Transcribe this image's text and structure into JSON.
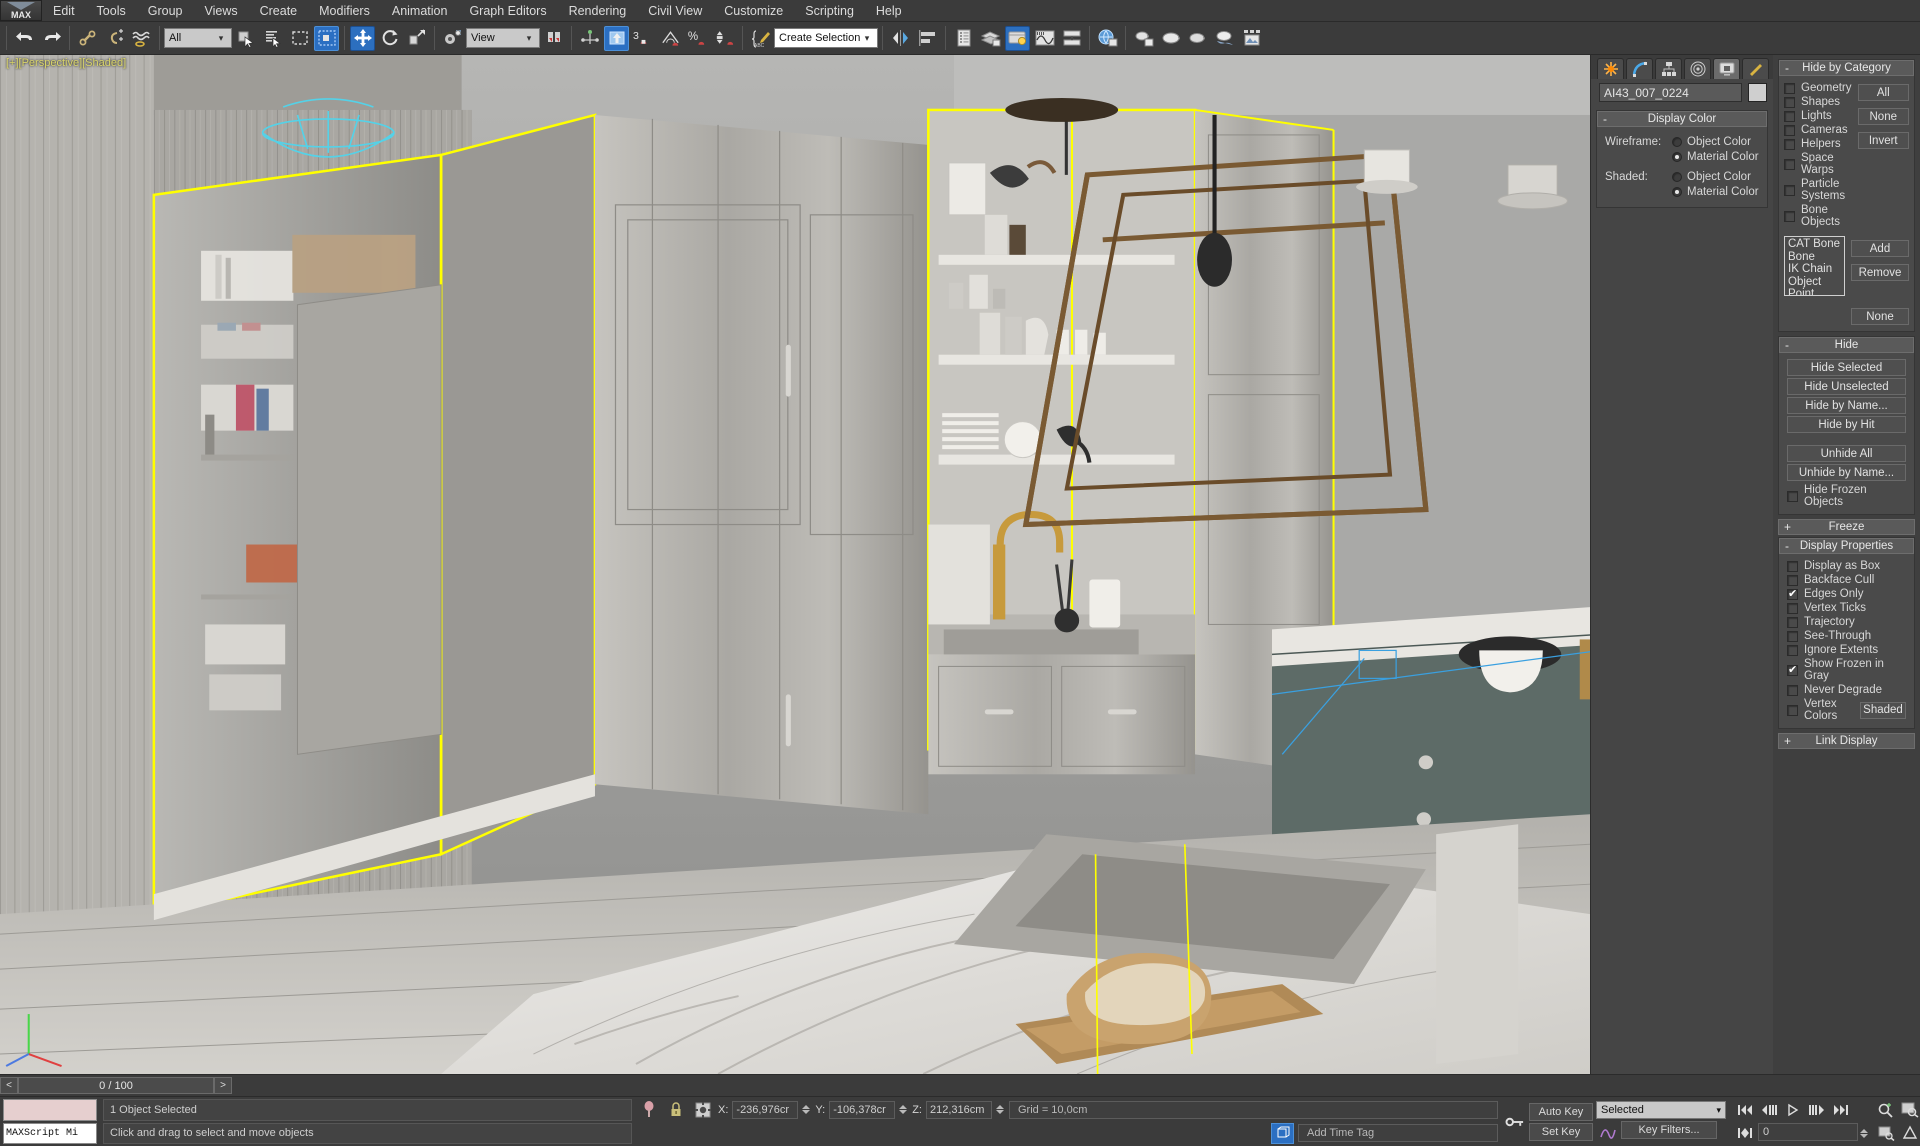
{
  "app": {
    "logo": "MAX",
    "viewport_label": "[+][Perspective][Shaded]"
  },
  "menubar": {
    "items": [
      "Edit",
      "Tools",
      "Group",
      "Views",
      "Create",
      "Modifiers",
      "Animation",
      "Graph Editors",
      "Rendering",
      "Civil View",
      "Customize",
      "Scripting",
      "Help"
    ]
  },
  "toolbar": {
    "selection_filter": "All",
    "reference_coord": "View",
    "named_selection_sets": "Create Selection Se",
    "icons": [
      "undo-icon",
      "redo-icon",
      "select-link-icon",
      "unlink-icon",
      "bind-space-warp-icon",
      "select-object-icon",
      "select-by-name-icon",
      "rectangular-region-icon",
      "window-crossing-icon",
      "select-move-icon",
      "select-rotate-icon",
      "select-scale-icon",
      "use-center-icon",
      "mirror-icon",
      "align-icon",
      "percent-snap-icon",
      "spinner-snap-icon",
      "snaps-toggle-icon",
      "angle-snap-icon",
      "edit-named-selection-icon",
      "mirror-tool-icon",
      "layer-manager-icon",
      "curve-editor-icon",
      "schematic-view-icon",
      "material-editor-icon",
      "render-setup-icon",
      "rendered-frame-icon",
      "render-production-icon"
    ]
  },
  "command_panel": {
    "tabs": [
      "create-tab",
      "modify-tab",
      "hierarchy-tab",
      "motion-tab",
      "display-tab",
      "utilities-tab"
    ],
    "selected_tab": "display-tab",
    "object_name": "AI43_007_0224",
    "display_color": {
      "title": "Display Color",
      "wireframe_label": "Wireframe:",
      "shaded_label": "Shaded:",
      "options": [
        "Object Color",
        "Material Color"
      ],
      "wireframe_selected": "Material Color",
      "shaded_selected": "Material Color"
    },
    "hide_by_category": {
      "title": "Hide by Category",
      "categories": [
        {
          "label": "Geometry",
          "checked": false
        },
        {
          "label": "Shapes",
          "checked": false
        },
        {
          "label": "Lights",
          "checked": false
        },
        {
          "label": "Cameras",
          "checked": false
        },
        {
          "label": "Helpers",
          "checked": false
        },
        {
          "label": "Space Warps",
          "checked": false
        },
        {
          "label": "Particle Systems",
          "checked": false
        },
        {
          "label": "Bone Objects",
          "checked": false
        }
      ],
      "buttons": [
        "All",
        "None",
        "Invert"
      ],
      "list_items": [
        "CAT Bone",
        "Bone",
        "IK Chain Object",
        "Point"
      ],
      "list_buttons": [
        "Add",
        "Remove",
        "None"
      ]
    },
    "hide": {
      "title": "Hide",
      "buttons": [
        "Hide Selected",
        "Hide Unselected",
        "Hide by Name...",
        "Hide by Hit",
        "Unhide All",
        "Unhide by Name..."
      ],
      "frozen_checkbox": {
        "label": "Hide Frozen Objects",
        "checked": false
      }
    },
    "freeze": {
      "title": "Freeze",
      "collapsed": true
    },
    "display_properties": {
      "title": "Display Properties",
      "items": [
        {
          "label": "Display as Box",
          "checked": false
        },
        {
          "label": "Backface Cull",
          "checked": false
        },
        {
          "label": "Edges Only",
          "checked": true
        },
        {
          "label": "Vertex Ticks",
          "checked": false
        },
        {
          "label": "Trajectory",
          "checked": false
        },
        {
          "label": "See-Through",
          "checked": false
        },
        {
          "label": "Ignore Extents",
          "checked": false
        },
        {
          "label": "Show Frozen in Gray",
          "checked": true
        },
        {
          "label": "Never Degrade",
          "checked": false
        },
        {
          "label": "Vertex Colors",
          "checked": false
        }
      ],
      "shaded_button": "Shaded"
    },
    "link_display": {
      "title": "Link Display",
      "collapsed": true
    }
  },
  "time_slider": {
    "value": "0 / 100",
    "prev": "<",
    "next": ">"
  },
  "status_bar": {
    "maxscript_label": "MAXScript Mi",
    "selection_status": "1 Object Selected",
    "prompt": "Click and drag to select and move objects",
    "coords": [
      {
        "axis": "X:",
        "value": "-236,976cr"
      },
      {
        "axis": "Y:",
        "value": "-106,378cr"
      },
      {
        "axis": "Z:",
        "value": "212,316cm"
      }
    ],
    "grid": "Grid = 10,0cm",
    "add_time_tag": "Add Time Tag"
  },
  "animation_bar": {
    "auto_key": "Auto Key",
    "set_key": "Set Key",
    "key_mode": "Selected",
    "key_filters": "Key Filters...",
    "frame_value": "0",
    "transport_icons": [
      "go-to-start-icon",
      "previous-frame-icon",
      "play-animation-icon",
      "next-frame-icon",
      "go-to-end-icon",
      "key-mode-toggle-icon"
    ],
    "nav_icons": [
      "zoom-icon",
      "zoom-all-icon",
      "zoom-extents-icon",
      "zoom-extents-all-icon",
      "field-of-view-icon",
      "pan-icon",
      "orbit-icon",
      "maximize-viewport-icon"
    ]
  },
  "colors": {
    "accent": "#2c6fbf",
    "panel": "#454545",
    "toolbar": "#3b3b3b",
    "selection_highlight": "#ffff00",
    "viewport_bg": "#8a8a8a"
  }
}
